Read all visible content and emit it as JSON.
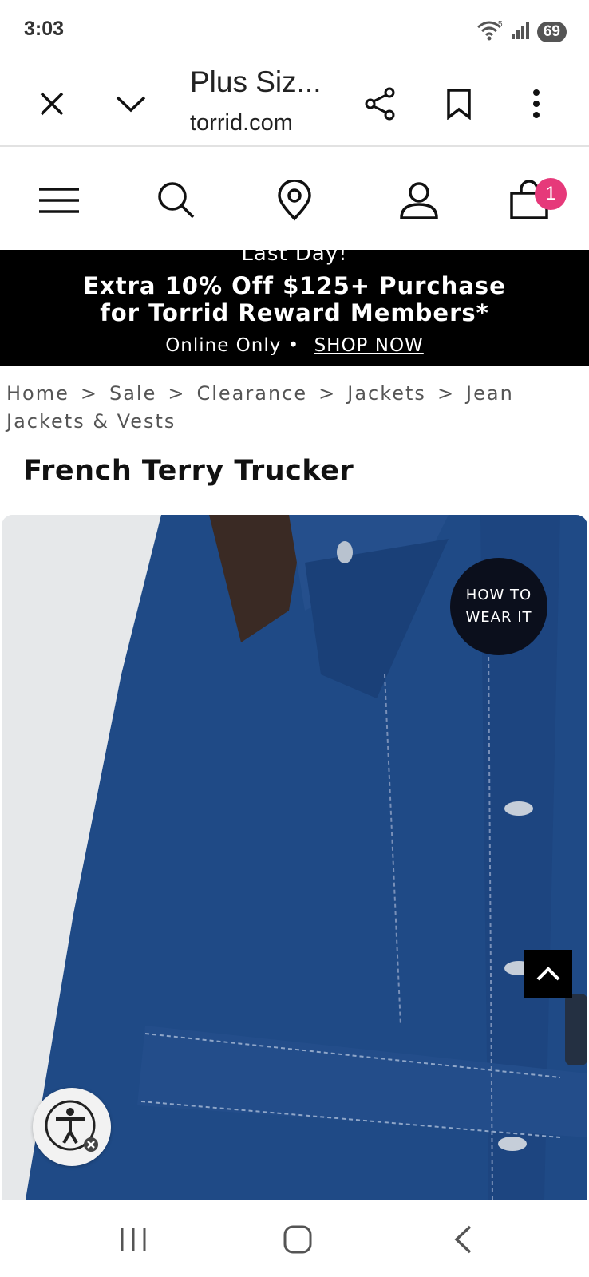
{
  "status": {
    "time": "3:03",
    "battery": "69",
    "wifi_label": "5"
  },
  "browser": {
    "title": "Plus Siz...",
    "domain": "torrid.com"
  },
  "site_header": {
    "cart_count": "1"
  },
  "promo": {
    "top_line": "Last Day!",
    "line1": "Extra 10% Off $125+ Purchase",
    "line2": "for Torrid Reward Members*",
    "online_only": "Online Only •",
    "shop_now": "SHOP NOW"
  },
  "breadcrumb": {
    "items": [
      "Home",
      "Sale",
      "Clearance",
      "Jackets",
      "Jean Jackets & Vests"
    ],
    "separator": ">"
  },
  "product": {
    "title": "French Terry Trucker",
    "how_to_line1": "HOW TO",
    "how_to_line2": "WEAR IT"
  },
  "colors": {
    "denim": "#1f4a86",
    "badge": "#e6397a",
    "banner": "#000000"
  }
}
